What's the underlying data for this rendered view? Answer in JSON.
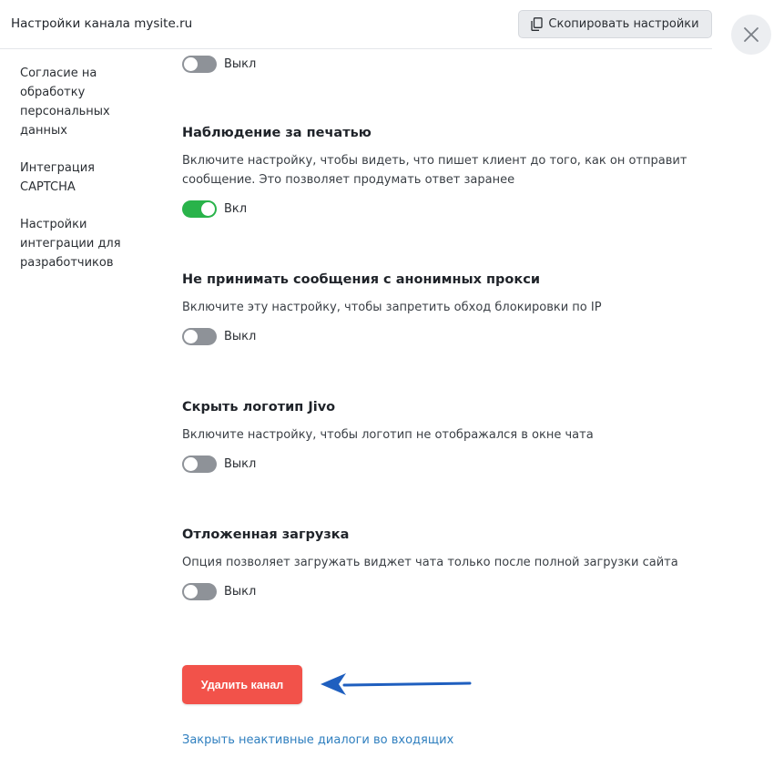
{
  "header": {
    "title": "Настройки канала mysite.ru",
    "copy_button": "Скопировать настройки",
    "copy_icon": "copy-icon",
    "close_icon": "close-icon"
  },
  "sidebar": {
    "items": [
      {
        "label": "Согласие на обработку персональных данных"
      },
      {
        "label": "Интеграция CAPTCHA"
      },
      {
        "label": "Настройки интеграции для разработчиков"
      }
    ]
  },
  "top_toggle": {
    "state": "off",
    "label": "Выкл"
  },
  "settings": [
    {
      "title": "Наблюдение за печатью",
      "description": "Включите настройку, чтобы видеть, что пишет клиент до того, как он отправит сообщение. Это позволяет продумать ответ заранее",
      "state": "on",
      "toggle_label": "Вкл"
    },
    {
      "title": "Не принимать сообщения с анонимных прокси",
      "description": "Включите эту настройку, чтобы запретить обход блокировки по IP",
      "state": "off",
      "toggle_label": "Выкл"
    },
    {
      "title": "Скрыть логотип Jivo",
      "description": "Включите настройку, чтобы логотип не отображался в окне чата",
      "state": "off",
      "toggle_label": "Выкл"
    },
    {
      "title": "Отложенная загрузка",
      "description": "Опция позволяет загружать виджет чата только после полной загрузки сайта",
      "state": "off",
      "toggle_label": "Выкл"
    }
  ],
  "actions": {
    "delete_button": "Удалить канал",
    "close_inactive_link": "Закрыть неактивные диалоги во входящих"
  },
  "colors": {
    "toggle_on": "#29b34a",
    "toggle_off": "#8e9298",
    "delete_button": "#f2524a",
    "link": "#2f7fbf",
    "annotation_arrow": "#1f5fbf"
  }
}
